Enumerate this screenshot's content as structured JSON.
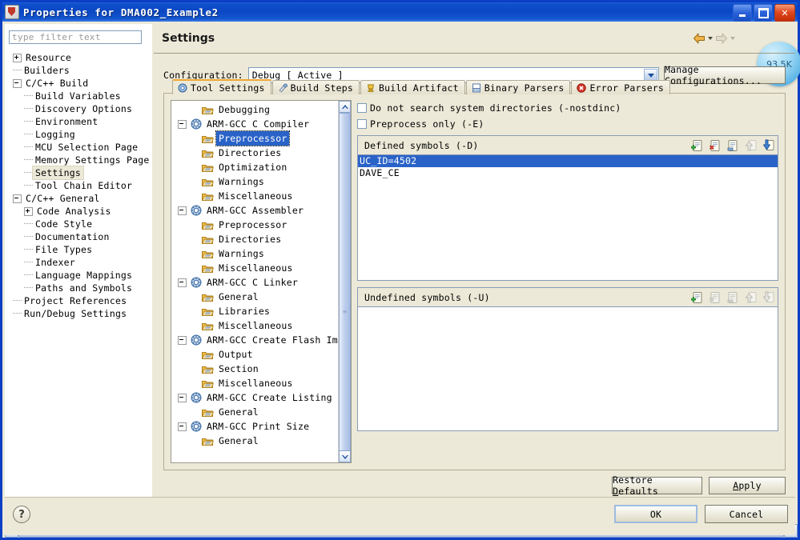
{
  "window": {
    "title": "Properties for DMA002_Example2",
    "minimize_label": "Minimize",
    "maximize_label": "Maximize",
    "close_label": "Close",
    "titlebar_color": "#0a47c4"
  },
  "left": {
    "filter_placeholder": "type filter text",
    "filter_value": "",
    "tree": [
      {
        "label": "Resource",
        "depth": 0,
        "toggle": "plus"
      },
      {
        "label": "Builders",
        "depth": 0,
        "toggle": "none"
      },
      {
        "label": "C/C++ Build",
        "depth": 0,
        "toggle": "minus"
      },
      {
        "label": "Build Variables",
        "depth": 1,
        "toggle": "none"
      },
      {
        "label": "Discovery Options",
        "depth": 1,
        "toggle": "none"
      },
      {
        "label": "Environment",
        "depth": 1,
        "toggle": "none"
      },
      {
        "label": "Logging",
        "depth": 1,
        "toggle": "none"
      },
      {
        "label": "MCU Selection Page",
        "depth": 1,
        "toggle": "none"
      },
      {
        "label": "Memory Settings Page",
        "depth": 1,
        "toggle": "none"
      },
      {
        "label": "Settings",
        "depth": 1,
        "toggle": "none",
        "selected": true
      },
      {
        "label": "Tool Chain Editor",
        "depth": 1,
        "toggle": "none"
      },
      {
        "label": "C/C++ General",
        "depth": 0,
        "toggle": "minus"
      },
      {
        "label": "Code Analysis",
        "depth": 1,
        "toggle": "plus"
      },
      {
        "label": "Code Style",
        "depth": 1,
        "toggle": "none"
      },
      {
        "label": "Documentation",
        "depth": 1,
        "toggle": "none"
      },
      {
        "label": "File Types",
        "depth": 1,
        "toggle": "none"
      },
      {
        "label": "Indexer",
        "depth": 1,
        "toggle": "none"
      },
      {
        "label": "Language Mappings",
        "depth": 1,
        "toggle": "none"
      },
      {
        "label": "Paths and Symbols",
        "depth": 1,
        "toggle": "none"
      },
      {
        "label": "Project References",
        "depth": 0,
        "toggle": "none"
      },
      {
        "label": "Run/Debug Settings",
        "depth": 0,
        "toggle": "none"
      }
    ],
    "hscroll_left_label": "‹",
    "hscroll_right_label": "›"
  },
  "page": {
    "title": "Settings",
    "back_label": "Back",
    "forward_label": "Forward",
    "bubble_text": "93.5K"
  },
  "configuration": {
    "label": "Configuration:",
    "value": "Debug  [ Active ]",
    "manage_button": "Manage Configurations..."
  },
  "tabs": [
    {
      "label": "Tool Settings",
      "icon": "tool-settings-icon",
      "active": true
    },
    {
      "label": "Build Steps",
      "icon": "build-steps-icon",
      "active": false
    },
    {
      "label": "Build Artifact",
      "icon": "build-artifact-icon",
      "active": false
    },
    {
      "label": "Binary Parsers",
      "icon": "binary-parsers-icon",
      "active": false
    },
    {
      "label": "Error Parsers",
      "icon": "error-parsers-icon",
      "active": false
    }
  ],
  "tool_tree": [
    {
      "label": "Debugging",
      "depth": 1,
      "toggle": "none",
      "icon": "folder"
    },
    {
      "label": "ARM-GCC C Compiler",
      "depth": 0,
      "toggle": "minus",
      "icon": "gear"
    },
    {
      "label": "Preprocessor",
      "depth": 1,
      "toggle": "none",
      "icon": "folder",
      "selected": true
    },
    {
      "label": "Directories",
      "depth": 1,
      "toggle": "none",
      "icon": "folder"
    },
    {
      "label": "Optimization",
      "depth": 1,
      "toggle": "none",
      "icon": "folder"
    },
    {
      "label": "Warnings",
      "depth": 1,
      "toggle": "none",
      "icon": "folder"
    },
    {
      "label": "Miscellaneous",
      "depth": 1,
      "toggle": "none",
      "icon": "folder"
    },
    {
      "label": "ARM-GCC Assembler",
      "depth": 0,
      "toggle": "minus",
      "icon": "gear"
    },
    {
      "label": "Preprocessor",
      "depth": 1,
      "toggle": "none",
      "icon": "folder"
    },
    {
      "label": "Directories",
      "depth": 1,
      "toggle": "none",
      "icon": "folder"
    },
    {
      "label": "Warnings",
      "depth": 1,
      "toggle": "none",
      "icon": "folder"
    },
    {
      "label": "Miscellaneous",
      "depth": 1,
      "toggle": "none",
      "icon": "folder"
    },
    {
      "label": "ARM-GCC C Linker",
      "depth": 0,
      "toggle": "minus",
      "icon": "gear"
    },
    {
      "label": "General",
      "depth": 1,
      "toggle": "none",
      "icon": "folder"
    },
    {
      "label": "Libraries",
      "depth": 1,
      "toggle": "none",
      "icon": "folder"
    },
    {
      "label": "Miscellaneous",
      "depth": 1,
      "toggle": "none",
      "icon": "folder"
    },
    {
      "label": "ARM-GCC Create Flash Image",
      "depth": 0,
      "toggle": "minus",
      "icon": "gear"
    },
    {
      "label": "Output",
      "depth": 1,
      "toggle": "none",
      "icon": "folder"
    },
    {
      "label": "Section",
      "depth": 1,
      "toggle": "none",
      "icon": "folder"
    },
    {
      "label": "Miscellaneous",
      "depth": 1,
      "toggle": "none",
      "icon": "folder"
    },
    {
      "label": "ARM-GCC Create Listing",
      "depth": 0,
      "toggle": "minus",
      "icon": "gear"
    },
    {
      "label": "General",
      "depth": 1,
      "toggle": "none",
      "icon": "folder"
    },
    {
      "label": "ARM-GCC Print Size",
      "depth": 0,
      "toggle": "minus",
      "icon": "gear"
    },
    {
      "label": "General",
      "depth": 1,
      "toggle": "none",
      "icon": "folder"
    }
  ],
  "options": {
    "checkboxes": [
      {
        "label": "Do not search system directories (-nostdinc)",
        "checked": false
      },
      {
        "label": "Preprocess only (-E)",
        "checked": false
      }
    ],
    "defined": {
      "title": "Defined symbols (-D)",
      "symbols": [
        {
          "value": "UC_ID=4502",
          "selected": true
        },
        {
          "value": "DAVE_CE",
          "selected": false
        }
      ],
      "icons": [
        {
          "name": "add-icon",
          "enabled": true
        },
        {
          "name": "delete-icon",
          "enabled": true
        },
        {
          "name": "edit-icon",
          "enabled": true
        },
        {
          "name": "move-up-icon",
          "enabled": false
        },
        {
          "name": "move-down-icon",
          "enabled": true
        }
      ]
    },
    "undefined": {
      "title": "Undefined symbols (-U)",
      "symbols": [],
      "icons": [
        {
          "name": "add-icon",
          "enabled": true
        },
        {
          "name": "delete-icon",
          "enabled": false
        },
        {
          "name": "edit-icon",
          "enabled": false
        },
        {
          "name": "move-up-icon",
          "enabled": false
        },
        {
          "name": "move-down-icon",
          "enabled": false
        }
      ]
    }
  },
  "buttons": {
    "restore_defaults": "Restore Defaults",
    "restore_defaults_mnemonic": "D",
    "apply": "Apply",
    "apply_mnemonic": "A",
    "ok": "OK",
    "cancel": "Cancel",
    "help": "?"
  }
}
